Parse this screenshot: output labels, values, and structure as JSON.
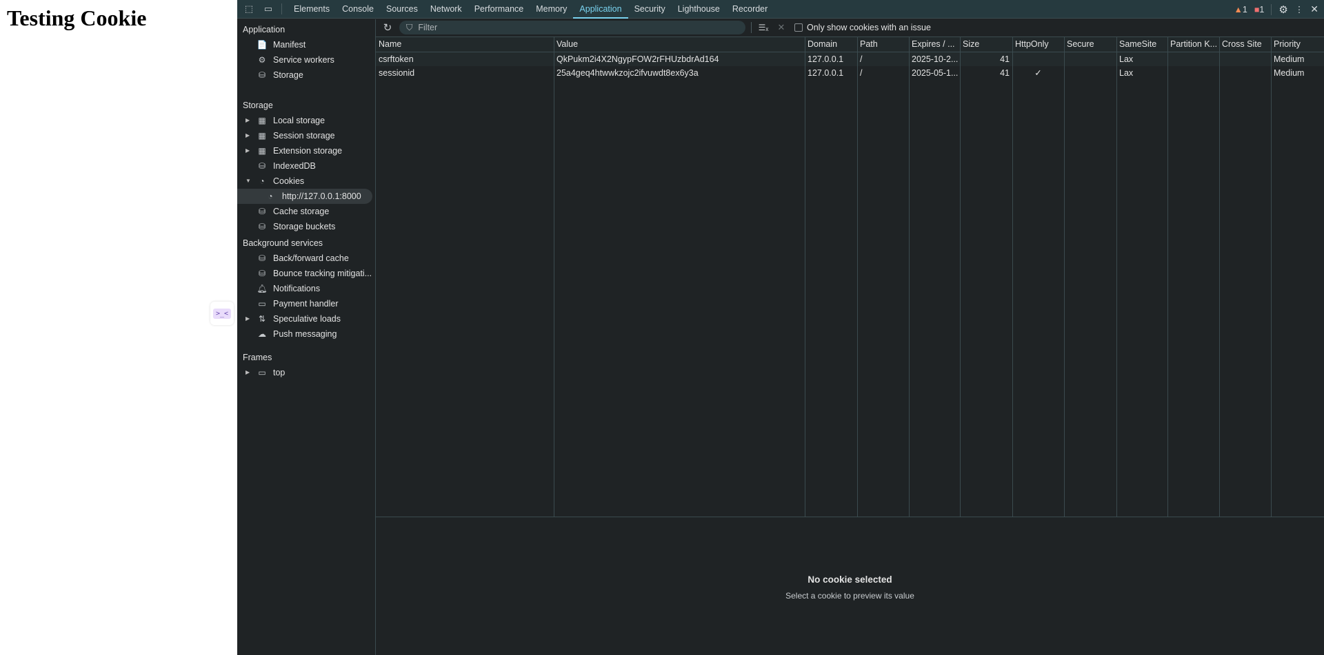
{
  "page": {
    "title": "Testing Cookie"
  },
  "dock": {
    "label": ">_<"
  },
  "tabs": [
    "Elements",
    "Console",
    "Sources",
    "Network",
    "Performance",
    "Memory",
    "Application",
    "Security",
    "Lighthouse",
    "Recorder"
  ],
  "active_tab": "Application",
  "status": {
    "warnings": "1",
    "errors": "1"
  },
  "sidebar": {
    "application": {
      "header": "Application",
      "items": [
        "Manifest",
        "Service workers",
        "Storage"
      ]
    },
    "storage": {
      "header": "Storage",
      "items": [
        "Local storage",
        "Session storage",
        "Extension storage",
        "IndexedDB",
        "Cookies",
        "http://127.0.0.1:8000",
        "Cache storage",
        "Storage buckets"
      ]
    },
    "background": {
      "header": "Background services",
      "items": [
        "Back/forward cache",
        "Bounce tracking mitigati...",
        "Notifications",
        "Payment handler",
        "Speculative loads",
        "Push messaging"
      ]
    },
    "frames": {
      "header": "Frames",
      "items": [
        "top"
      ]
    }
  },
  "filter": {
    "placeholder": "Filter",
    "issue_label": "Only show cookies with an issue"
  },
  "table": {
    "columns": [
      "Name",
      "Value",
      "Domain",
      "Path",
      "Expires / ...",
      "Size",
      "HttpOnly",
      "Secure",
      "SameSite",
      "Partition K...",
      "Cross Site",
      "Priority"
    ],
    "rows": [
      [
        "csrftoken",
        "QkPukm2i4X2NgypFOW2rFHUzbdrAd164",
        "127.0.0.1",
        "/",
        "2025-10-2...",
        "41",
        "",
        "",
        "Lax",
        "",
        "",
        "Medium"
      ],
      [
        "sessionid",
        "25a4geq4htwwkzojc2ifvuwdt8ex6y3a",
        "127.0.0.1",
        "/",
        "2025-05-1...",
        "41",
        "✓",
        "",
        "Lax",
        "",
        "",
        "Medium"
      ]
    ]
  },
  "preview": {
    "title": "No cookie selected",
    "subtitle": "Select a cookie to preview its value"
  },
  "colors": {
    "accent": "#7ad3f0",
    "toolbar": "#263a3f",
    "panel": "#1f2325"
  }
}
